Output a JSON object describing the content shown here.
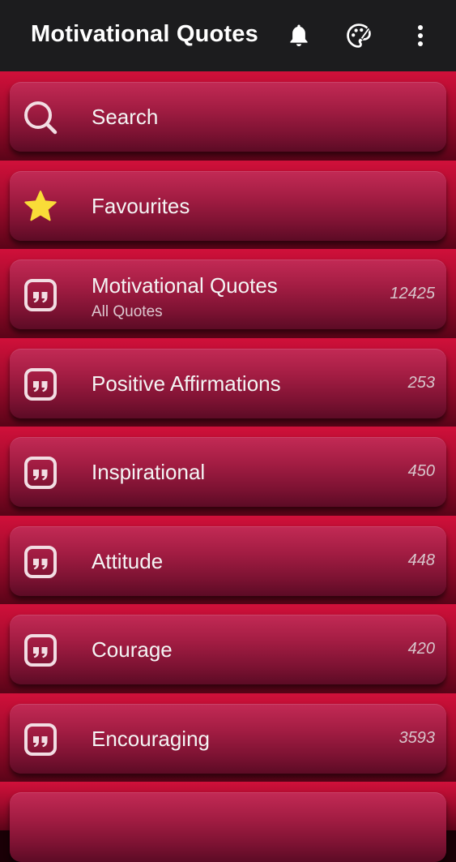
{
  "appbar": {
    "title": "Motivational Quotes",
    "icons": [
      "bell-icon",
      "palette-icon",
      "more-vert-icon"
    ]
  },
  "colors": {
    "appbar": "#1c1c1e",
    "band": "#c20d36",
    "card": "#a11c42",
    "star": "#f9dc38"
  },
  "items": [
    {
      "icon": "search-icon",
      "title": "Search"
    },
    {
      "icon": "star-icon",
      "title": "Favourites"
    },
    {
      "icon": "quote-icon",
      "title": "Motivational Quotes",
      "subtitle": "All Quotes",
      "count": "12425"
    },
    {
      "icon": "quote-icon",
      "title": "Positive Affirmations",
      "count": "253"
    },
    {
      "icon": "quote-icon",
      "title": "Inspirational",
      "count": "450"
    },
    {
      "icon": "quote-icon",
      "title": "Attitude",
      "count": "448"
    },
    {
      "icon": "quote-icon",
      "title": "Courage",
      "count": "420"
    },
    {
      "icon": "quote-icon",
      "title": "Encouraging",
      "count": "3593"
    }
  ]
}
